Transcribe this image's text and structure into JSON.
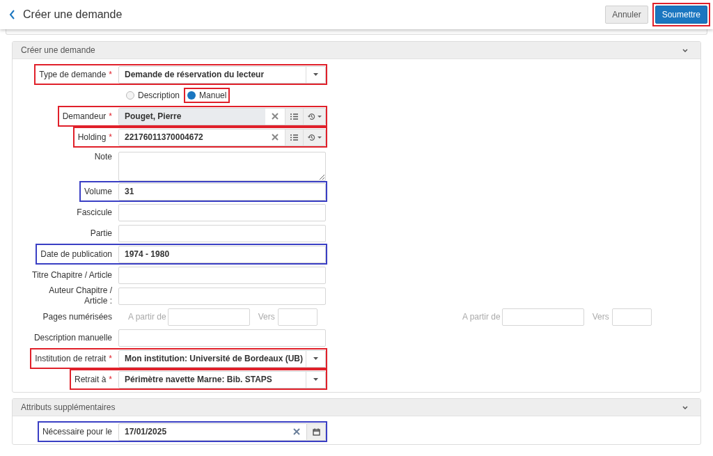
{
  "header": {
    "title": "Créer une demande",
    "buttons": [
      {
        "label": "Annuler",
        "kind": "secondary"
      },
      {
        "label": "Soumettre",
        "kind": "primary",
        "color": "#e0202a"
      }
    ]
  },
  "sections": [
    {
      "title": "Créer une demande",
      "rows": [
        {
          "kind": "select",
          "label": "Type de demande",
          "required_mark": "*",
          "value": "Demande de réservation du lecteur",
          "color": "#e0202a"
        },
        {
          "kind": "radio",
          "options": [
            {
              "label": "Description",
              "selected": false
            },
            {
              "label": "Manuel",
              "selected": true,
              "color": "#e0202a"
            }
          ]
        },
        {
          "kind": "lookup",
          "label": "Demandeur",
          "required_mark": "*",
          "value": "Pouget, Pierre",
          "readonly": true,
          "color": "#e0202a"
        },
        {
          "kind": "lookup",
          "label": "Holding",
          "required_mark": "*",
          "value": "22176011370004672",
          "readonly": false,
          "color": "#e0202a"
        },
        {
          "kind": "textarea",
          "label": "Note"
        },
        {
          "kind": "text",
          "label": "Volume",
          "value": "31",
          "color": "#3a3fc4"
        },
        {
          "kind": "text",
          "label": "Fascicule"
        },
        {
          "kind": "text",
          "label": "Partie"
        },
        {
          "kind": "text",
          "label": "Date de publication",
          "value": "1974 - 1980",
          "color": "#3a3fc4"
        },
        {
          "kind": "text",
          "label": "Titre Chapitre / Article"
        },
        {
          "kind": "text",
          "label": "Auteur Chapitre / Article :"
        },
        {
          "kind": "pages",
          "label": "Pages numérisées",
          "groups": [
            {
              "from": "A partir de",
              "to": "Vers"
            },
            {
              "from": "A partir de",
              "to": "Vers"
            }
          ]
        },
        {
          "kind": "text",
          "label": "Description manuelle"
        },
        {
          "kind": "select",
          "label": "Institution de retrait",
          "required_mark": "*",
          "value": "Mon institution: Université de Bordeaux (UB)",
          "color": "#e0202a"
        },
        {
          "kind": "select",
          "label": "Retrait à",
          "required_mark": "*",
          "value": "Périmètre navette Marne: Bib. STAPS",
          "color": "#e0202a"
        }
      ]
    },
    {
      "title": "Attributs supplémentaires",
      "rows": [
        {
          "kind": "date",
          "label": "Nécessaire pour le",
          "value": "17/01/2025",
          "color": "#3a3fc4"
        }
      ]
    }
  ]
}
